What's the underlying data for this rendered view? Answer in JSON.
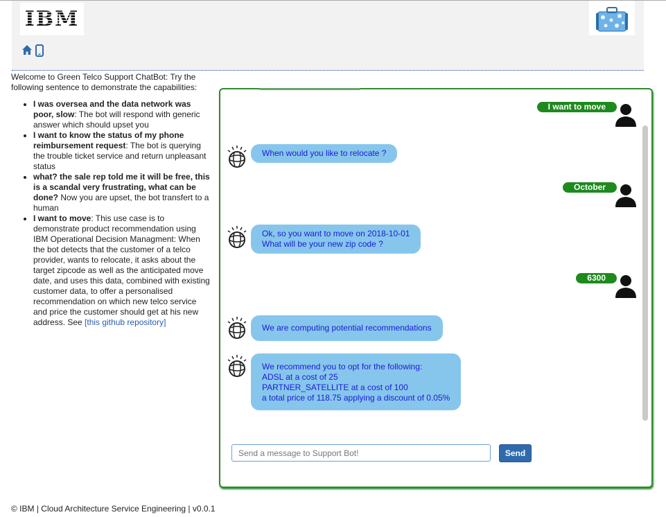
{
  "header": {
    "logo_text": "IBM",
    "logo_icon": "ibm-logo",
    "bag_icon": "luggage-icon",
    "nav": [
      {
        "icon": "home-icon"
      },
      {
        "icon": "mobile-phone-icon"
      }
    ]
  },
  "intro": {
    "welcome": "Welcome to Green Telco Support ChatBot: Try the following sentence to demonstrate the capabilities:",
    "items": [
      {
        "bold": "I was oversea and the data network was poor, slow",
        "text": ": The bot will respond with generic answer which should upset you"
      },
      {
        "bold": "I want to know the status of my phone reimbursement request",
        "text": ": The bot is querying the trouble ticket service and return unpleasant status"
      },
      {
        "bold": "what? the sale rep told me it will be free, this is a scandal very frustrating, what can be done?",
        "text": " Now you are upset, the bot transfert to a human"
      },
      {
        "bold": "I want to move",
        "text": ": This use case is to demonstrate product recommendation using IBM Operational Decision Managment: When the bot detects that the customer of a telco provider, wants to relocate, it asks about the target zipcode as well as the anticipated move date, and uses this data, combined with existing customer data, to offer a personalised recommendation on which new telco service and price the customer should get at his new address. See ",
        "link": "[this github repository]"
      }
    ]
  },
  "chat": {
    "messages": [
      {
        "from": "user",
        "text": "I want to move"
      },
      {
        "from": "bot",
        "lines": [
          "When would you like to relocate ?"
        ]
      },
      {
        "from": "user",
        "text": "October"
      },
      {
        "from": "bot",
        "lines": [
          "Ok, so you want to move on 2018-10-01",
          "What will be your new zip code ?"
        ]
      },
      {
        "from": "user",
        "text": "6300"
      },
      {
        "from": "bot",
        "lines": [
          "We are computing potential recommendations"
        ]
      },
      {
        "from": "bot",
        "lines": [
          "We recommend you to opt for the following:",
          "ADSL at a cost of 25",
          "PARTNER_SATELLITE at a cost of 100",
          "a total price of 118.75 applying a discount of 0.05%"
        ]
      }
    ],
    "input_placeholder": "Send a message to Support Bot!",
    "input_value": "",
    "send_label": "Send"
  },
  "footer": {
    "text": "© IBM | Cloud Architecture Service Engineering | v0.0.1"
  },
  "colors": {
    "chat_border": "#2e8b2e",
    "user_bubble": "#1e8a1e",
    "bot_bubble": "#87c6ec",
    "bot_text": "#1a1ad6",
    "send_button": "#2f6aad",
    "link": "#2a5db0"
  }
}
